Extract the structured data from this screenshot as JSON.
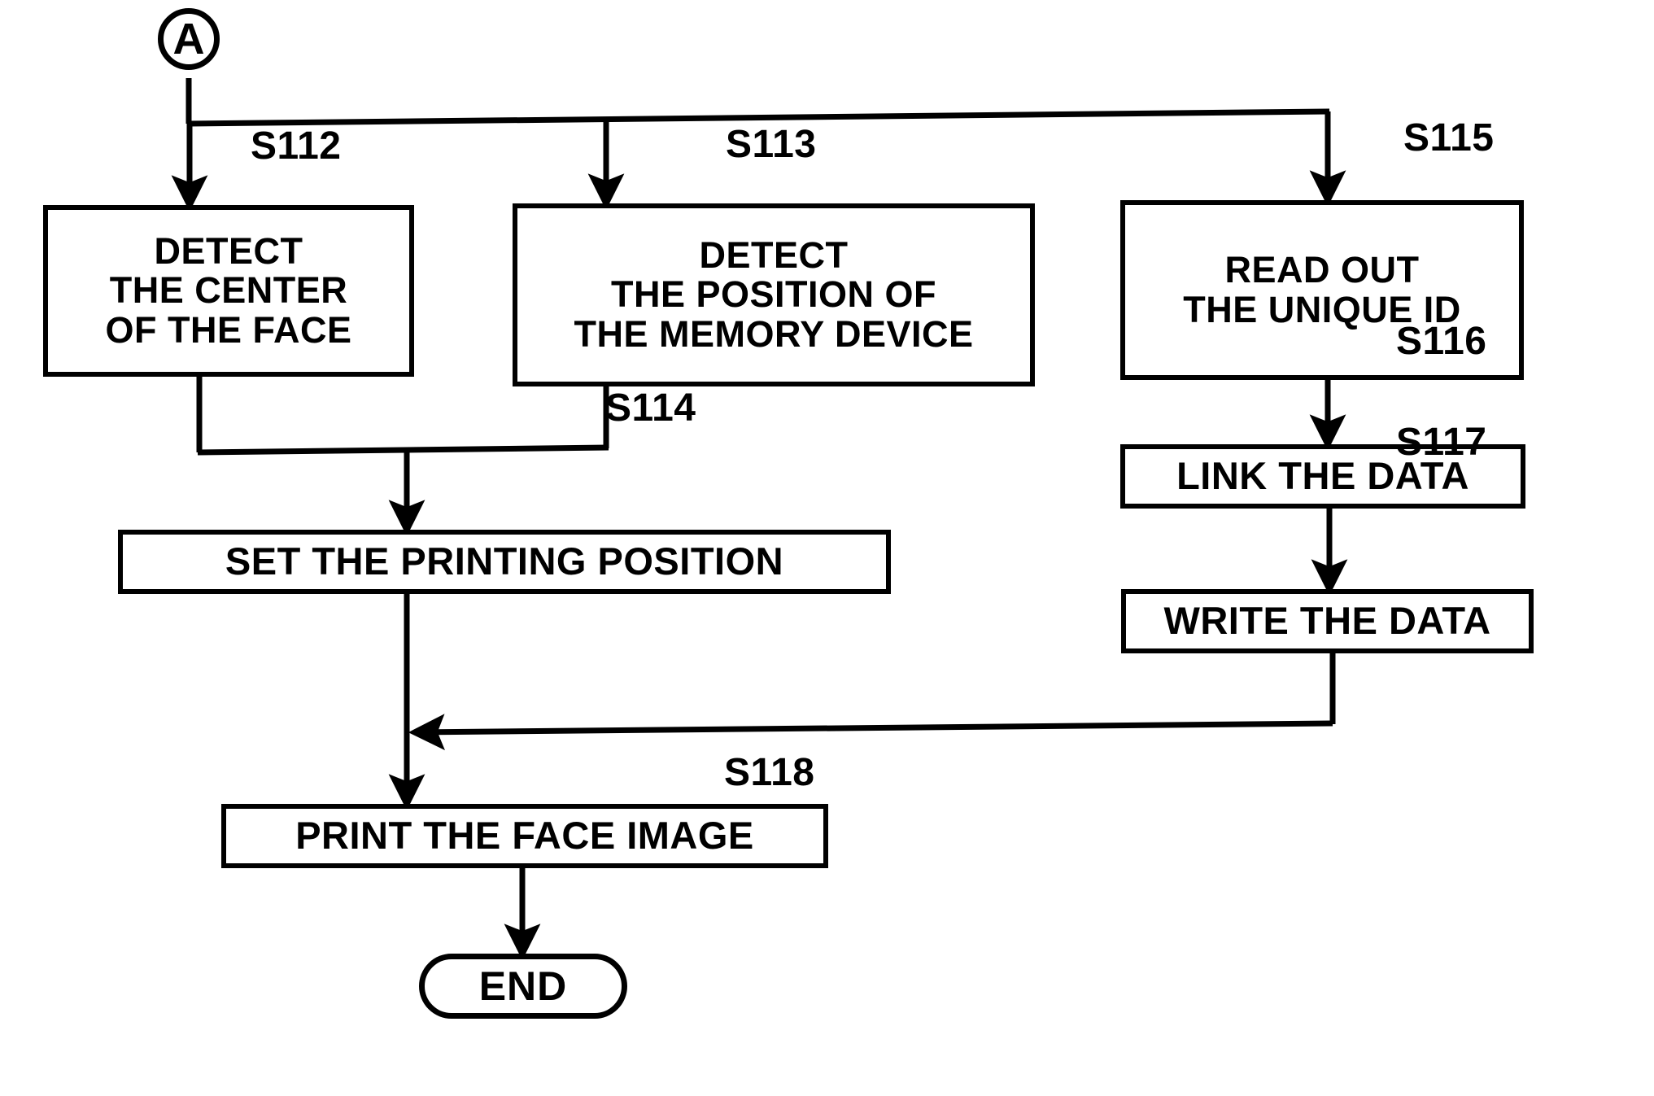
{
  "diagram": {
    "type": "flowchart",
    "title": "",
    "connector_in": {
      "label": "A"
    },
    "terminator_end": {
      "label": "END"
    },
    "nodes": [
      {
        "id": "S112",
        "step": "S112",
        "text": "DETECT\nTHE CENTER\nOF THE FACE"
      },
      {
        "id": "S113",
        "step": "S113",
        "text": "DETECT\nTHE POSITION OF\nTHE MEMORY DEVICE"
      },
      {
        "id": "S115",
        "step": "S115",
        "text": "READ OUT\nTHE UNIQUE ID"
      },
      {
        "id": "S114",
        "step": "S114",
        "text": "SET THE PRINTING POSITION"
      },
      {
        "id": "S116",
        "step": "S116",
        "text": "LINK THE DATA"
      },
      {
        "id": "S117",
        "step": "S117",
        "text": "WRITE THE DATA"
      },
      {
        "id": "S118",
        "step": "S118",
        "text": "PRINT THE FACE IMAGE"
      }
    ],
    "edges": [
      {
        "from": "A",
        "to": "S112"
      },
      {
        "from": "A",
        "to": "S113"
      },
      {
        "from": "A",
        "to": "S115"
      },
      {
        "from": "S112",
        "to": "S114"
      },
      {
        "from": "S113",
        "to": "S114"
      },
      {
        "from": "S114",
        "to": "S118"
      },
      {
        "from": "S115",
        "to": "S116"
      },
      {
        "from": "S116",
        "to": "S117"
      },
      {
        "from": "S117",
        "to": "S118"
      },
      {
        "from": "S118",
        "to": "END"
      }
    ],
    "colors": {
      "stroke": "#000000",
      "fill": "#ffffff"
    }
  }
}
